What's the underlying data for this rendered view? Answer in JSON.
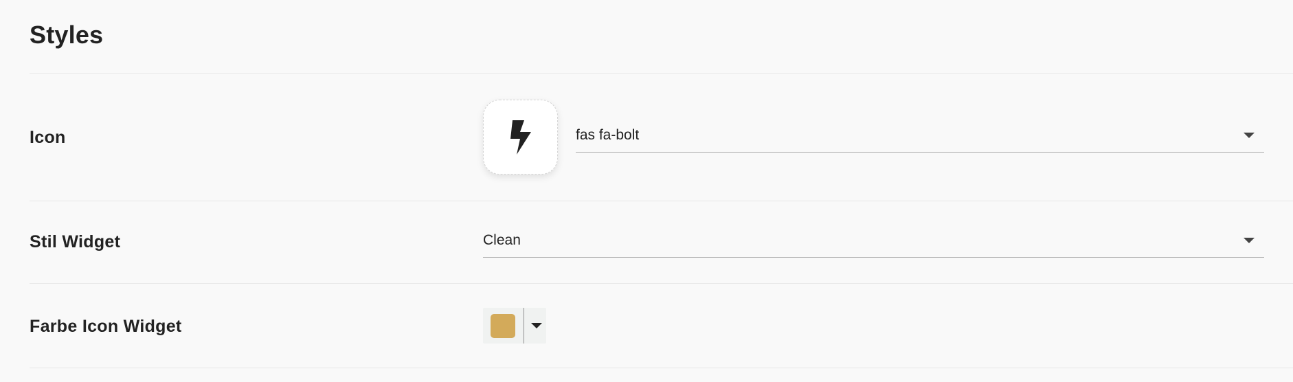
{
  "section": {
    "title": "Styles"
  },
  "rows": {
    "icon": {
      "label": "Icon",
      "selected_value": "fas fa-bolt",
      "preview_icon": "bolt-icon"
    },
    "style_widget": {
      "label": "Stil Widget",
      "selected_value": "Clean"
    },
    "icon_color": {
      "label": "Farbe Icon Widget",
      "swatch_color": "#d3aa5a"
    }
  }
}
